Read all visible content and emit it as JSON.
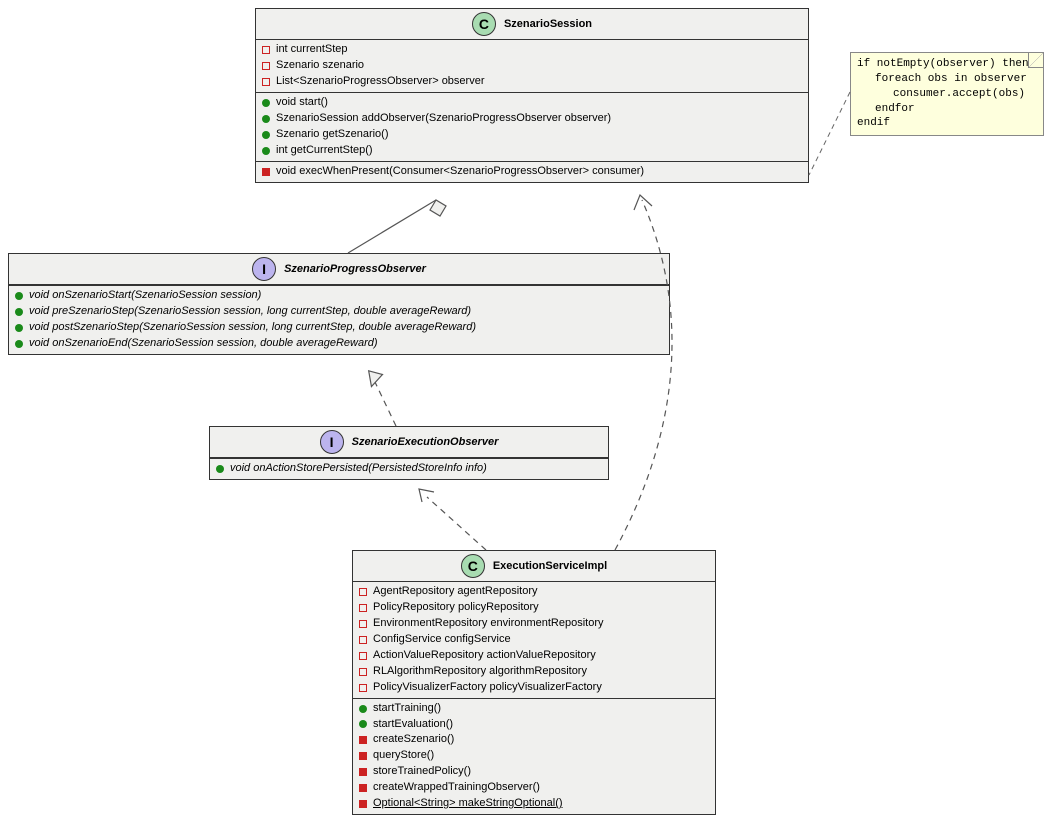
{
  "classes": {
    "szSession": {
      "name": "SzenarioSession",
      "stereotype": "C",
      "fields": [
        {
          "vis": "square-red-open",
          "sig": "int currentStep"
        },
        {
          "vis": "square-red-open",
          "sig": "Szenario szenario"
        },
        {
          "vis": "square-red-open",
          "sig": "List<SzenarioProgressObserver> observer"
        }
      ],
      "methodsPublic": [
        {
          "vis": "circle-green-filled",
          "sig": "void start()"
        },
        {
          "vis": "circle-green-filled",
          "sig": "SzenarioSession addObserver(SzenarioProgressObserver observer)"
        },
        {
          "vis": "circle-green-filled",
          "sig": "Szenario getSzenario()"
        },
        {
          "vis": "circle-green-filled",
          "sig": "int getCurrentStep()"
        }
      ],
      "methodsPrivate": [
        {
          "vis": "square-red-filled",
          "sig": "void execWhenPresent(Consumer<SzenarioProgressObserver> consumer)"
        }
      ]
    },
    "progObs": {
      "name": "SzenarioProgressObserver",
      "stereotype": "I",
      "methods": [
        {
          "vis": "circle-green-filled",
          "sig": "void onSzenarioStart(SzenarioSession session)"
        },
        {
          "vis": "circle-green-filled",
          "sig": "void preSzenarioStep(SzenarioSession session, long currentStep, double averageReward)"
        },
        {
          "vis": "circle-green-filled",
          "sig": "void postSzenarioStep(SzenarioSession session, long currentStep, double averageReward)"
        },
        {
          "vis": "circle-green-filled",
          "sig": "void onSzenarioEnd(SzenarioSession session, double averageReward)"
        }
      ]
    },
    "execObs": {
      "name": "SzenarioExecutionObserver",
      "stereotype": "I",
      "methods": [
        {
          "vis": "circle-green-filled",
          "sig": "void onActionStorePersisted(PersistedStoreInfo info)"
        }
      ]
    },
    "execSvc": {
      "name": "ExecutionServiceImpl",
      "stereotype": "C",
      "fields": [
        {
          "vis": "square-red-open",
          "sig": "AgentRepository agentRepository"
        },
        {
          "vis": "square-red-open",
          "sig": "PolicyRepository policyRepository"
        },
        {
          "vis": "square-red-open",
          "sig": "EnvironmentRepository environmentRepository"
        },
        {
          "vis": "square-red-open",
          "sig": "ConfigService configService"
        },
        {
          "vis": "square-red-open",
          "sig": "ActionValueRepository actionValueRepository"
        },
        {
          "vis": "square-red-open",
          "sig": "RLAlgorithmRepository algorithmRepository"
        },
        {
          "vis": "square-red-open",
          "sig": "PolicyVisualizerFactory policyVisualizerFactory"
        }
      ],
      "methods": [
        {
          "vis": "circle-green-filled",
          "sig": "startTraining()"
        },
        {
          "vis": "circle-green-filled",
          "sig": "startEvaluation()"
        },
        {
          "vis": "square-red-filled",
          "sig": "createSzenario()"
        },
        {
          "vis": "square-red-filled",
          "sig": "queryStore()"
        },
        {
          "vis": "square-red-filled",
          "sig": "storeTrainedPolicy()"
        },
        {
          "vis": "square-red-filled",
          "sig": "createWrappedTrainingObserver()"
        },
        {
          "vis": "square-red-filled",
          "sig": "Optional<String> makeStringOptional()",
          "underline": true
        }
      ]
    }
  },
  "note": {
    "lines": [
      "if notEmpty(observer) then",
      "foreach obs in observer",
      "consumer.accept(obs)",
      "endfor",
      "endif"
    ]
  }
}
